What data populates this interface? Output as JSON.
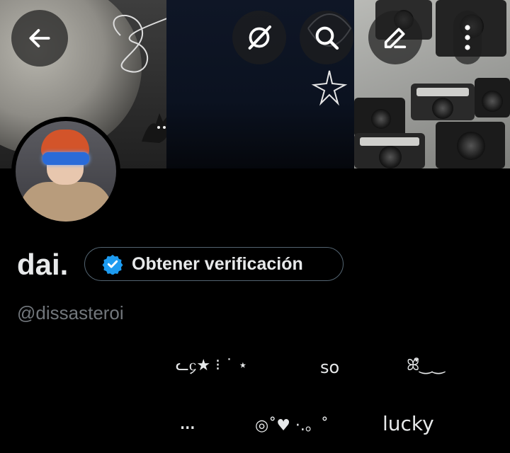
{
  "header": {
    "back_icon": "arrow-left-icon",
    "buttons": [
      {
        "name": "grok-icon"
      },
      {
        "name": "search-icon"
      },
      {
        "name": "edit-icon"
      },
      {
        "name": "more-vertical-icon"
      }
    ]
  },
  "profile": {
    "display_name": "dai.",
    "verify_button_label": "Obtener verificación",
    "verify_icon": "verified-badge-icon",
    "handle": "@dissasteroi"
  },
  "bio": {
    "row1": [
      "ᓚ᧔★ ⁝ ˙ ⋆",
      "so",
      "ꕤ͒‿‿"
    ],
    "row2": [
      "ꓺꓸ",
      "◎˚♥ ·.。˚",
      "lucky"
    ]
  },
  "colors": {
    "background": "#000000",
    "text_primary": "#e7e9ea",
    "text_secondary": "#71767b",
    "verified_blue": "#1d9bf0",
    "button_border": "#536471"
  }
}
